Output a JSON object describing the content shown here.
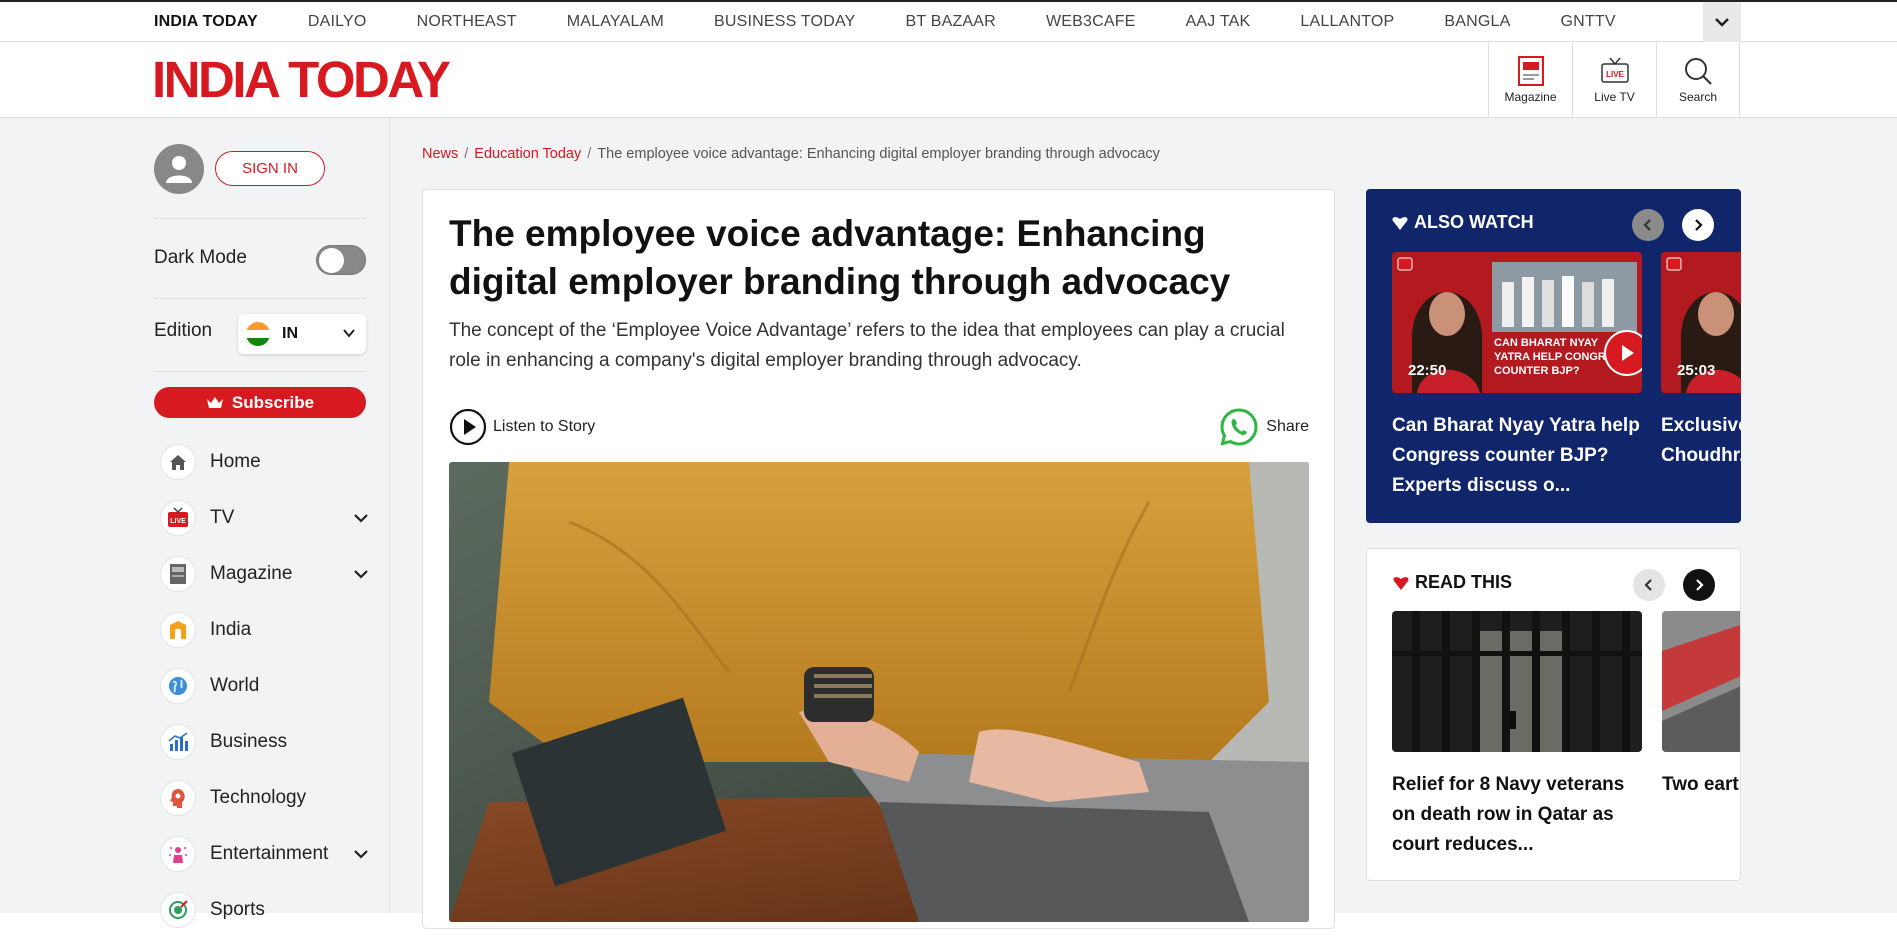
{
  "topnav": {
    "links": [
      "INDIA TODAY",
      "DAILYO",
      "NORTHEAST",
      "MALAYALAM",
      "BUSINESS TODAY",
      "BT BAZAAR",
      "WEB3CAFE",
      "AAJ TAK",
      "LALLANTOP",
      "BANGLA",
      "GNTTV"
    ],
    "more_icon": "chevron-down-icon"
  },
  "header": {
    "logo": "INDIA TODAY",
    "icons": [
      {
        "label": "Magazine",
        "icon": "magazine-icon"
      },
      {
        "label": "Live TV",
        "icon": "live-tv-icon"
      },
      {
        "label": "Search",
        "icon": "search-icon"
      }
    ]
  },
  "sidebar": {
    "signin_label": "SIGN IN",
    "dark_mode_label": "Dark Mode",
    "dark_mode_on": false,
    "edition_label": "Edition",
    "edition_value": "IN",
    "subscribe_label": "Subscribe",
    "nav": [
      {
        "label": "Home",
        "icon": "home-icon",
        "expandable": false
      },
      {
        "label": "TV",
        "icon": "live-tv-icon",
        "expandable": true
      },
      {
        "label": "Magazine",
        "icon": "magazine-icon",
        "expandable": true
      },
      {
        "label": "India",
        "icon": "india-gate-icon",
        "expandable": false
      },
      {
        "label": "World",
        "icon": "globe-icon",
        "expandable": false
      },
      {
        "label": "Business",
        "icon": "bar-chart-icon",
        "expandable": false
      },
      {
        "label": "Technology",
        "icon": "brain-icon",
        "expandable": false
      },
      {
        "label": "Entertainment",
        "icon": "entertainment-icon",
        "expandable": true
      },
      {
        "label": "Sports",
        "icon": "sports-icon",
        "expandable": false
      }
    ]
  },
  "breadcrumb": [
    "News",
    "Education Today",
    "The employee voice advantage: Enhancing digital employer branding through advocacy"
  ],
  "article": {
    "title": "The employee voice advantage: Enhancing digital employer branding through advocacy",
    "subtitle": "The concept of the ‘Employee Voice Advantage’ refers to the idea that employees can play a crucial role in enhancing a company's digital employer branding through advocacy.",
    "listen_label": "Listen to Story",
    "share_label": "Share"
  },
  "also_watch": {
    "title": "ALSO WATCH",
    "cards": [
      {
        "duration": "22:50",
        "title": "Can Bharat Nyay Yatra help Congress counter BJP? Experts discuss o...",
        "thumb_text": "CAN BHARAT NYAY YATRA HELP CONGRESS COUNTER BJP?"
      },
      {
        "duration": "25:03",
        "title": "Exclusive Kaul spe Choudhr..."
      }
    ]
  },
  "read_this": {
    "title": "READ THIS",
    "cards": [
      {
        "title": "Relief for 8 Navy veterans on death row in Qatar as court reduces..."
      },
      {
        "title": "Two eart magnitu Japan co"
      }
    ]
  },
  "colors": {
    "brand_red": "#d71920",
    "watch_bg": "#10256a",
    "page_bg": "#f1f3f5"
  }
}
